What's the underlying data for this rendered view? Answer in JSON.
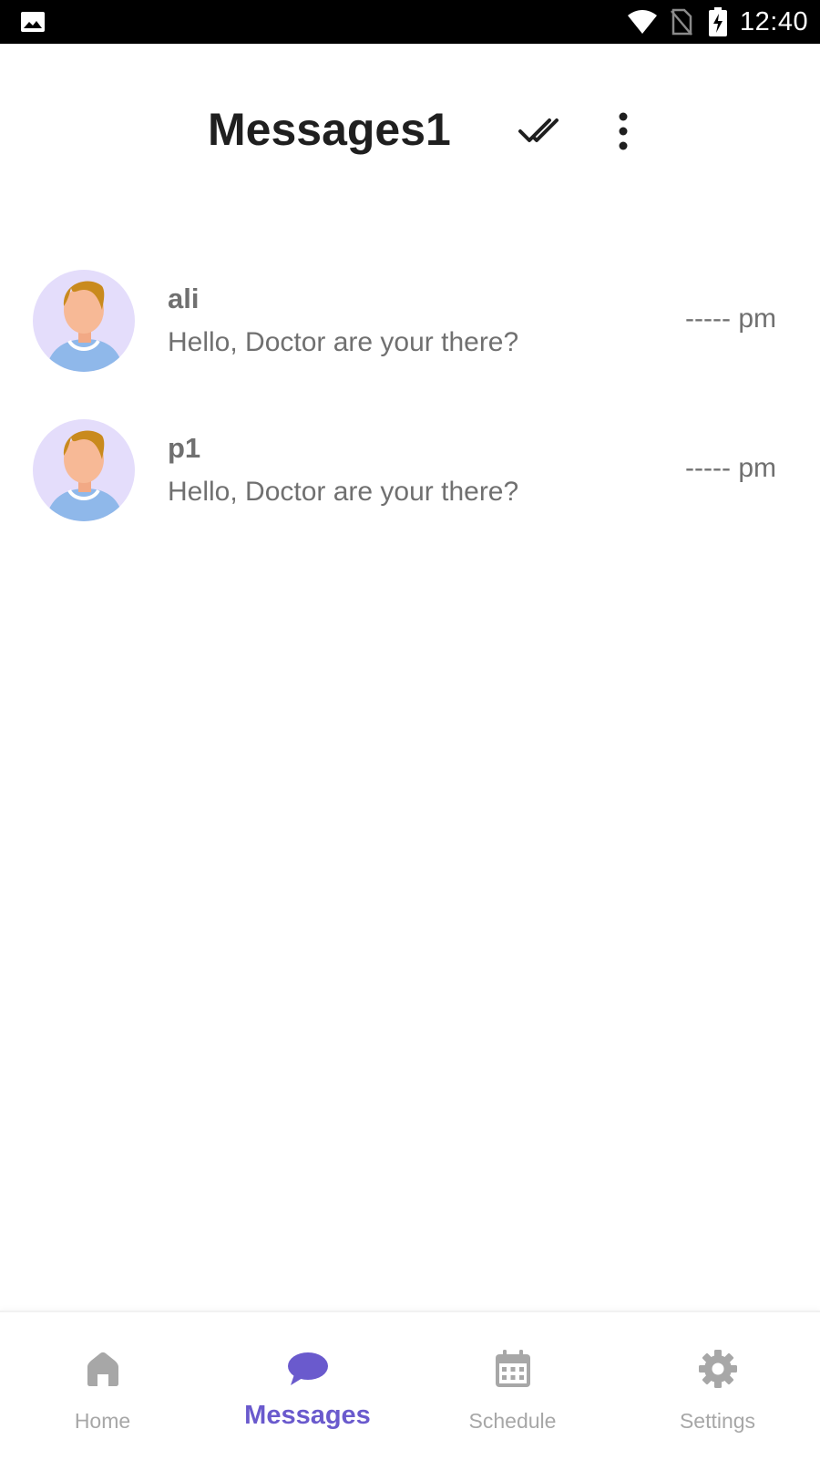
{
  "status_bar": {
    "time": "12:40",
    "icons": [
      "gallery-icon",
      "wifi-icon",
      "no-sim-icon",
      "battery-charging-icon"
    ]
  },
  "header": {
    "title": "Messages1",
    "actions": [
      "double-check-icon",
      "more-vertical-icon"
    ]
  },
  "chats": [
    {
      "name": "ali",
      "preview": "Hello, Doctor are your there?",
      "time": "----- pm",
      "avatar_icon": "user-avatar-icon"
    },
    {
      "name": "p1",
      "preview": "Hello, Doctor are your there?",
      "time": "----- pm",
      "avatar_icon": "user-avatar-icon"
    }
  ],
  "bottom_nav": {
    "items": [
      {
        "label": "Home",
        "icon": "home-icon",
        "active": false
      },
      {
        "label": "Messages",
        "icon": "chat-bubble-icon",
        "active": true
      },
      {
        "label": "Schedule",
        "icon": "calendar-icon",
        "active": false
      },
      {
        "label": "Settings",
        "icon": "gear-icon",
        "active": false
      }
    ]
  },
  "colors": {
    "accent": "#6a5acd",
    "inactive": "#a7a7a7",
    "text_secondary": "#707070",
    "title": "#1f1f1f",
    "avatar_bg": "#e4ddfb"
  }
}
